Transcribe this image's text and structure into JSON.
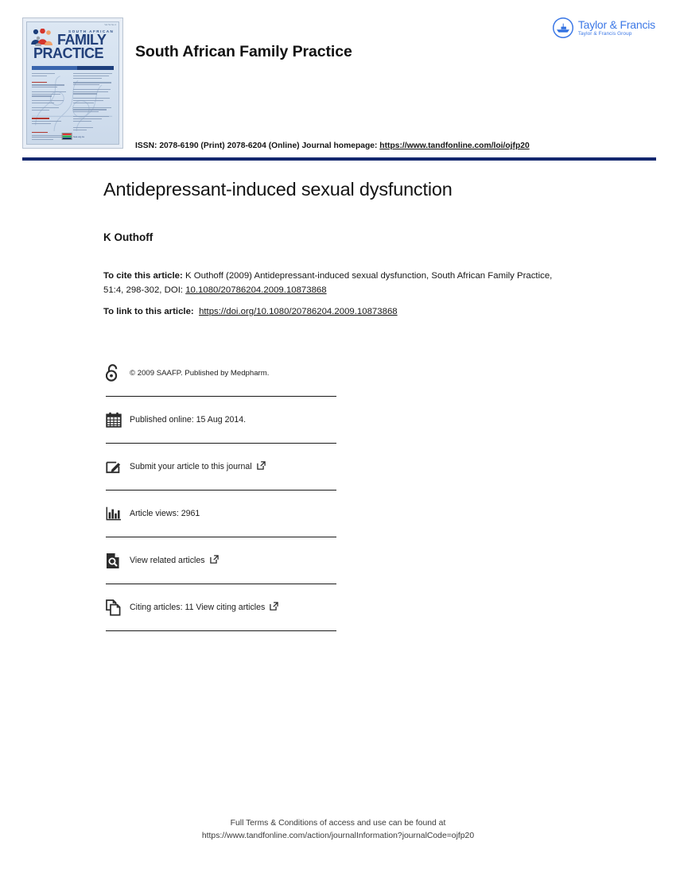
{
  "header": {
    "journal_title": "South African Family Practice",
    "issn_text": "ISSN: 2078-6190 (Print) 2078-6204 (Online) Journal homepage: ",
    "issn_link": "https://www.tandfonline.com/loi/ojfp20",
    "publisher": {
      "name": "Taylor & Francis",
      "group": "Taylor & Francis Group",
      "brand_color": "#3c78e6"
    },
    "rule_color": "#13276e",
    "cover": {
      "top_label": "Vol 51 No 4",
      "country_line": "SOUTH AFRICAN",
      "title_line1": "FAMILY",
      "title_line2": "PRACTICE",
      "logo_text": "fsas.org.za"
    }
  },
  "article": {
    "title": "Antidepressant-induced sexual dysfunction",
    "author": "K Outhoff",
    "cite_label": "To cite this article:",
    "cite_text": " K Outhoff (2009) Antidepressant-induced sexual dysfunction, South African Family Practice, 51:4, 298-302, DOI: ",
    "cite_doi": "10.1080/20786204.2009.10873868",
    "link_label": "To link to this article:",
    "link_url": "https://doi.org/10.1080/20786204.2009.10873868"
  },
  "metadata": {
    "rows": [
      {
        "icon": "open-access-lock-icon",
        "label": "© 2009 SAAFP. Published by Medpharm.",
        "external": false,
        "small": true
      },
      {
        "icon": "calendar-icon",
        "label": "Published online: 15 Aug 2014.",
        "external": false,
        "small": false
      },
      {
        "icon": "pencil-edit-icon",
        "label": "Submit your article to this journal",
        "external": true,
        "small": false
      },
      {
        "icon": "bar-chart-icon",
        "label": "Article views: 2961",
        "external": false,
        "small": false
      },
      {
        "icon": "document-search-icon",
        "label": "View related articles",
        "external": true,
        "small": false
      },
      {
        "icon": "copy-documents-icon",
        "label": "Citing articles: 11 View citing articles",
        "external": true,
        "small": false
      }
    ]
  },
  "footer": {
    "line1": "Full Terms & Conditions of access and use can be found at",
    "line2": "https://www.tandfonline.com/action/journalInformation?journalCode=ojfp20"
  }
}
